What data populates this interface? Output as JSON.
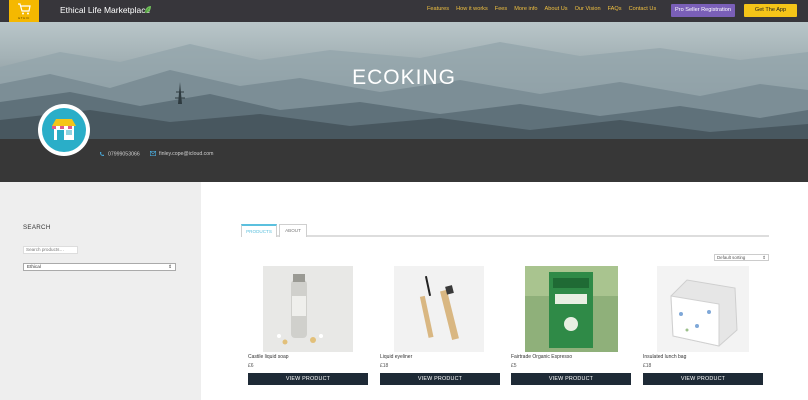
{
  "nav": {
    "logo_text": "ETHIC",
    "title": "Ethical Life Marketplace",
    "menu": [
      "Features",
      "How it works",
      "Fees",
      "More info",
      "About Us",
      "Our Vision",
      "FAQs",
      "Contact Us"
    ],
    "pro_button": "Pro Seller Registration",
    "app_button": "Get The App"
  },
  "hero": {
    "title": "ECOKING"
  },
  "store": {
    "phone": "07999053066",
    "email": "finley.cope@icloud.com",
    "avatar_label": "Store"
  },
  "sidebar": {
    "title": "SEARCH",
    "search_placeholder": "Search products…",
    "category": "Ethical"
  },
  "tabs": [
    "PRODUCTS",
    "ABOUT"
  ],
  "sort": "Default sorting",
  "products": [
    {
      "name": "Castile liquid soap",
      "price": "£6",
      "button": "VIEW PRODUCT"
    },
    {
      "name": "Liquid eyeliner",
      "price": "£18",
      "button": "VIEW PRODUCT"
    },
    {
      "name": "Fairtrade Organic Espresso",
      "price": "£5",
      "button": "VIEW PRODUCT"
    },
    {
      "name": "Insulated lunch bag",
      "price": "£18",
      "button": "VIEW PRODUCT"
    }
  ],
  "colors": {
    "nav_bg": "#37363b",
    "accent_yellow": "#f5c518",
    "pro_purple": "#7a5fb8",
    "button_dark": "#1e2a36",
    "tab_active": "#5bc0de"
  }
}
